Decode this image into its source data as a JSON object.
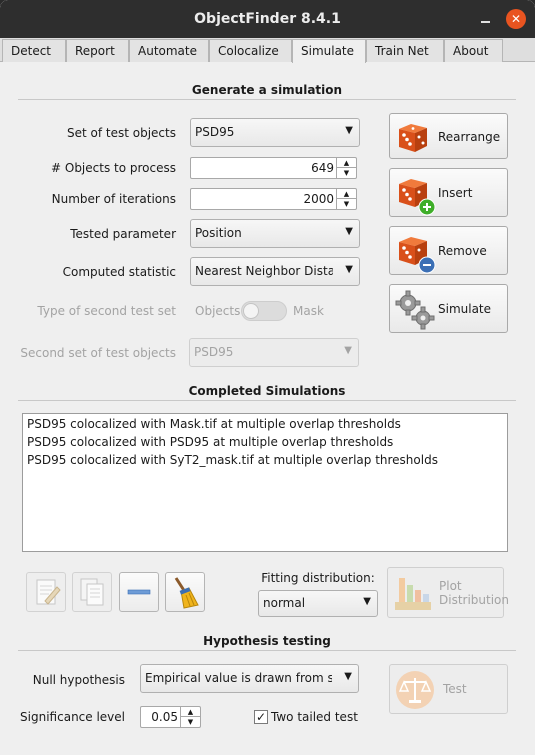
{
  "window": {
    "title": "ObjectFinder 8.4.1",
    "minimize": "",
    "close": "✕"
  },
  "tabs": [
    "Detect",
    "Report",
    "Automate",
    "Colocalize",
    "Simulate",
    "Train Net",
    "About"
  ],
  "generate": {
    "heading": "Generate a simulation",
    "test_objects_label": "Set of test objects",
    "test_objects_value": "PSD95",
    "objects_to_process_label": "# Objects to process",
    "objects_to_process_value": "649",
    "iterations_label": "Number of iterations",
    "iterations_value": "2000",
    "tested_parameter_label": "Tested parameter",
    "tested_parameter_value": "Position",
    "computed_statistic_label": "Computed statistic",
    "computed_statistic_value": "Nearest Neighbor Dista...",
    "second_type_label": "Type of second test set",
    "second_type_left": "Objects",
    "second_type_right": "Mask",
    "second_set_label": "Second set of test objects",
    "second_set_value": "PSD95"
  },
  "actions": {
    "rearrange": "Rearrange",
    "insert": "Insert",
    "remove": "Remove",
    "simulate": "Simulate"
  },
  "completed": {
    "heading": "Completed Simulations",
    "items": [
      "PSD95 colocalized with Mask.tif at multiple overlap thresholds",
      "PSD95 colocalized with PSD95 at multiple overlap thresholds",
      "PSD95 colocalized with SyT2_mask.tif at multiple overlap thresholds"
    ]
  },
  "fitting": {
    "label": "Fitting distribution:",
    "value": "normal",
    "plot_button_line1": "Plot",
    "plot_button_line2": "Distribution"
  },
  "hypothesis": {
    "heading": "Hypothesis testing",
    "null_label": "Null hypothesis",
    "null_value": "Empirical value is drawn from sa...",
    "significance_label": "Significance level",
    "significance_value": "0.05",
    "two_tailed_label": "Two tailed test",
    "two_tailed_checked": true,
    "test_button": "Test"
  },
  "colors": {
    "titlebar": "#2e2e2e",
    "close": "#e95420",
    "dice": "#e2561c",
    "insert_plus": "#3fae29",
    "remove_minus": "#3b6fb5"
  }
}
